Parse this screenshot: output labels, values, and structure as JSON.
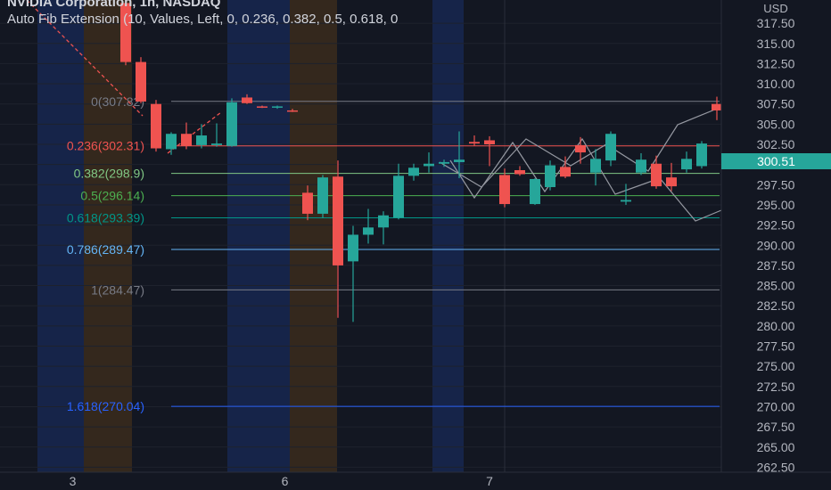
{
  "title": "NVIDIA Corporation, 1h, NASDAQ",
  "subtitle": "Auto Fib Extension (10, Values, Left, 0, 0.236, 0.382, 0.5, 0.618, 0",
  "currency": "USD",
  "last_price": "300.51",
  "colors": {
    "background": "#131722",
    "up": "#26a69a",
    "down": "#ef5350",
    "grid": "#1e222d"
  },
  "chart_data": {
    "type": "candlestick",
    "y_axis": {
      "ticks": [
        "317.50",
        "315.00",
        "312.50",
        "310.00",
        "307.50",
        "305.00",
        "302.50",
        "300.00",
        "297.50",
        "295.00",
        "292.50",
        "290.00",
        "287.50",
        "285.00",
        "282.50",
        "280.00",
        "277.50",
        "275.00",
        "272.50",
        "270.00",
        "267.50",
        "265.00",
        "262.50"
      ]
    },
    "x_axis": {
      "ticks": [
        {
          "label": "3",
          "index": 3.5
        },
        {
          "label": "6",
          "index": 17.5
        },
        {
          "label": "7",
          "index": 31.0
        }
      ]
    },
    "fib_levels": [
      {
        "label": "0(307.82)",
        "value": 307.82,
        "color": "#787b86"
      },
      {
        "label": "0.236(302.31)",
        "value": 302.31,
        "color": "#ef5350"
      },
      {
        "label": "0.382(298.9)",
        "value": 298.9,
        "color": "#81c784"
      },
      {
        "label": "0.5(296.14)",
        "value": 296.14,
        "color": "#4caf50"
      },
      {
        "label": "0.618(293.39)",
        "value": 293.39,
        "color": "#009688"
      },
      {
        "label": "0.786(289.47)",
        "value": 289.47,
        "color": "#64b5f6"
      },
      {
        "label": "1(284.47)",
        "value": 284.47,
        "color": "#787b86"
      },
      {
        "label": "1.618(270.04)",
        "value": 270.04,
        "color": "#2962ff"
      }
    ],
    "candles": [
      {
        "o": 320,
        "h": 322,
        "l": 312.3,
        "c": 312.7
      },
      {
        "o": 312.7,
        "h": 313.3,
        "l": 307.6,
        "c": 307.8
      },
      {
        "o": 307.5,
        "h": 308.0,
        "l": 301.6,
        "c": 302.0
      },
      {
        "o": 301.9,
        "h": 304.0,
        "l": 301.2,
        "c": 303.8
      },
      {
        "o": 303.8,
        "h": 305.2,
        "l": 301.9,
        "c": 302.3
      },
      {
        "o": 302.4,
        "h": 305.0,
        "l": 302.0,
        "c": 303.6
      },
      {
        "o": 302.4,
        "h": 305.1,
        "l": 302.2,
        "c": 302.6
      },
      {
        "o": 302.3,
        "h": 308.2,
        "l": 302.2,
        "c": 307.7
      },
      {
        "o": 308.3,
        "h": 308.7,
        "l": 307.5,
        "c": 307.6
      },
      {
        "o": 307.2,
        "h": 307.3,
        "l": 307.0,
        "c": 307.1
      },
      {
        "o": 307.1,
        "h": 307.3,
        "l": 306.9,
        "c": 307.2
      },
      {
        "o": 306.7,
        "h": 306.9,
        "l": 306.5,
        "c": 306.6
      },
      {
        "o": 296.5,
        "h": 297.4,
        "l": 293.1,
        "c": 293.9
      },
      {
        "o": 293.9,
        "h": 298.7,
        "l": 293.4,
        "c": 298.4
      },
      {
        "o": 298.5,
        "h": 300.5,
        "l": 281.0,
        "c": 287.5
      },
      {
        "o": 288.0,
        "h": 292.4,
        "l": 280.5,
        "c": 291.3
      },
      {
        "o": 291.3,
        "h": 294.5,
        "l": 290.2,
        "c": 292.2
      },
      {
        "o": 292.2,
        "h": 294.2,
        "l": 290.1,
        "c": 293.7
      },
      {
        "o": 293.4,
        "h": 300.1,
        "l": 293.2,
        "c": 298.6
      },
      {
        "o": 298.6,
        "h": 300.1,
        "l": 298.0,
        "c": 299.6
      },
      {
        "o": 299.8,
        "h": 301.5,
        "l": 299.0,
        "c": 300.1
      },
      {
        "o": 300.1,
        "h": 300.6,
        "l": 299.7,
        "c": 300.3
      },
      {
        "o": 300.3,
        "h": 304.1,
        "l": 298.3,
        "c": 300.6
      },
      {
        "o": 302.8,
        "h": 303.6,
        "l": 302.3,
        "c": 302.6
      },
      {
        "o": 303.0,
        "h": 303.5,
        "l": 299.8,
        "c": 302.5
      },
      {
        "o": 298.7,
        "h": 299.5,
        "l": 294.7,
        "c": 295.1
      },
      {
        "o": 299.3,
        "h": 299.8,
        "l": 298.6,
        "c": 298.8
      },
      {
        "o": 295.1,
        "h": 298.3,
        "l": 295.0,
        "c": 298.2
      },
      {
        "o": 297.2,
        "h": 300.5,
        "l": 296.8,
        "c": 299.9
      },
      {
        "o": 299.7,
        "h": 301.0,
        "l": 298.3,
        "c": 298.5
      },
      {
        "o": 302.4,
        "h": 303.4,
        "l": 300.1,
        "c": 301.5
      },
      {
        "o": 299.0,
        "h": 301.9,
        "l": 297.4,
        "c": 300.7
      },
      {
        "o": 300.5,
        "h": 304.1,
        "l": 299.8,
        "c": 303.8
      },
      {
        "o": 295.4,
        "h": 297.6,
        "l": 295.0,
        "c": 295.6
      },
      {
        "o": 299.0,
        "h": 301.4,
        "l": 298.7,
        "c": 300.6
      },
      {
        "o": 300.1,
        "h": 301.1,
        "l": 297.0,
        "c": 297.3
      },
      {
        "o": 298.4,
        "h": 300.2,
        "l": 296.7,
        "c": 297.3
      },
      {
        "o": 299.4,
        "h": 301.6,
        "l": 299.0,
        "c": 300.7
      },
      {
        "o": 299.8,
        "h": 302.9,
        "l": 299.5,
        "c": 302.6
      },
      {
        "o": 307.5,
        "h": 308.4,
        "l": 305.5,
        "c": 306.7
      },
      {
        "o": 310.0,
        "h": 310.8,
        "l": 308.1,
        "c": 308.2
      }
    ]
  }
}
